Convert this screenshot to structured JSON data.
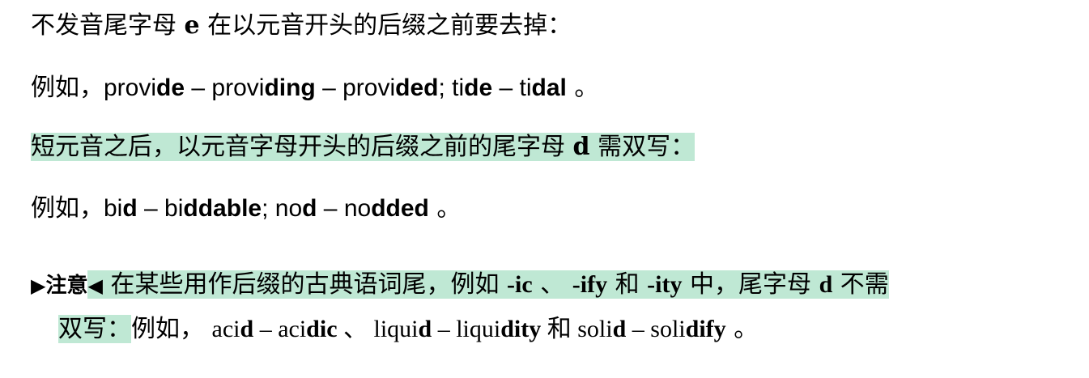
{
  "para1": {
    "t1": "不发音尾字母 ",
    "t2": "e",
    "t3": " 在以元音开头的后缀之前要去掉："
  },
  "para2": {
    "prefix": "例如，",
    "p1": "provi",
    "p2": "de",
    "p3": " – provi",
    "p4": "ding",
    "p5": " – provi",
    "p6": "ded",
    "p7": "; ti",
    "p8": "de",
    "p9": " – ti",
    "p10": "dal",
    "p11": " 。"
  },
  "para3": {
    "t1": "短元音之后，以元音字母开头的后缀之前的尾字母 ",
    "t2": "d",
    "t3": " 需双写："
  },
  "para4": {
    "prefix": "例如，",
    "p1": "bi",
    "p2": "d",
    "p3": " – bi",
    "p4": "ddable",
    "p5": "; no",
    "p6": "d",
    "p7": " – no",
    "p8": "dded",
    "p9": " 。"
  },
  "note": {
    "left_marker": "▶",
    "label": "注意",
    "right_marker": "◀",
    "t1": " 在某些用作后缀的古典语词尾，例如 ",
    "t2": "-ic",
    "t3": " 、 ",
    "t4": "-ify",
    "t5": " 和 ",
    "t6": "-ity",
    "t7": " 中，尾字母 ",
    "t8": "d",
    "t9": " 不需",
    "line2_hl": "双写：",
    "line2_t1": "例如， ",
    "w1": "aci",
    "w2": "d",
    "w3": " – aci",
    "w4": "dic",
    "w5": " 、 ",
    "w6": "liqui",
    "w7": "d",
    "w8": " – liqui",
    "w9": "dity",
    "w10": " 和 ",
    "w11": "soli",
    "w12": "d",
    "w13": " – soli",
    "w14": "dify",
    "w15": " 。"
  },
  "colors": {
    "highlight": "#bfe8d4",
    "text": "#000000"
  }
}
